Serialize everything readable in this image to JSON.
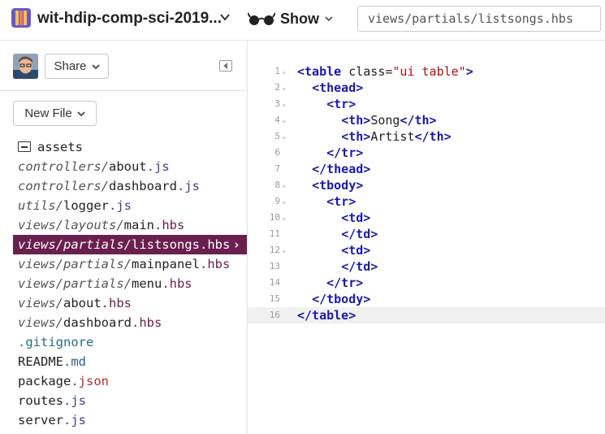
{
  "header": {
    "project_name": "wit-hdip-comp-sci-2019...",
    "show_label": "Show",
    "file_path": "views/partials/listsongs.hbs"
  },
  "sidebar": {
    "share_label": "Share",
    "new_file_label": "New File",
    "files": [
      {
        "dir": "",
        "name": "assets",
        "ext": "",
        "type": "folder"
      },
      {
        "dir": "controllers/",
        "name": "about",
        "ext": ".js"
      },
      {
        "dir": "controllers/",
        "name": "dashboard",
        "ext": ".js"
      },
      {
        "dir": "utils/",
        "name": "logger",
        "ext": ".js"
      },
      {
        "dir": "views/layouts/",
        "name": "main",
        "ext": ".hbs"
      },
      {
        "dir": "views/partials/",
        "name": "listsongs",
        "ext": ".hbs",
        "selected": true
      },
      {
        "dir": "views/partials/",
        "name": "mainpanel",
        "ext": ".hbs"
      },
      {
        "dir": "views/partials/",
        "name": "menu",
        "ext": ".hbs"
      },
      {
        "dir": "views/",
        "name": "about",
        "ext": ".hbs"
      },
      {
        "dir": "views/",
        "name": "dashboard",
        "ext": ".hbs"
      },
      {
        "dir": "",
        "name": ".gitignore",
        "ext": ""
      },
      {
        "dir": "",
        "name": "README",
        "ext": ".md"
      },
      {
        "dir": "",
        "name": "package",
        "ext": ".json"
      },
      {
        "dir": "",
        "name": "routes",
        "ext": ".js"
      },
      {
        "dir": "",
        "name": "server",
        "ext": ".js"
      }
    ]
  },
  "editor": {
    "active_line": 16,
    "lines": [
      {
        "n": "1",
        "fold": true,
        "indent": "",
        "parts": [
          [
            "tag",
            "<table"
          ],
          [
            "attr",
            " class="
          ],
          [
            "str",
            "\"ui table\""
          ],
          [
            "tag",
            ">"
          ]
        ]
      },
      {
        "n": "2",
        "fold": true,
        "indent": "  ",
        "parts": [
          [
            "tag",
            "<thead>"
          ]
        ]
      },
      {
        "n": "3",
        "fold": true,
        "indent": "    ",
        "parts": [
          [
            "tag",
            "<tr>"
          ]
        ]
      },
      {
        "n": "4",
        "fold": true,
        "indent": "      ",
        "parts": [
          [
            "tag",
            "<th>"
          ],
          [
            "txt",
            "Song"
          ],
          [
            "tag",
            "</th>"
          ]
        ]
      },
      {
        "n": "5",
        "fold": true,
        "indent": "      ",
        "parts": [
          [
            "tag",
            "<th>"
          ],
          [
            "txt",
            "Artist"
          ],
          [
            "tag",
            "</th>"
          ]
        ]
      },
      {
        "n": "6",
        "fold": false,
        "indent": "    ",
        "parts": [
          [
            "tag",
            "</tr>"
          ]
        ]
      },
      {
        "n": "7",
        "fold": false,
        "indent": "  ",
        "parts": [
          [
            "tag",
            "</thead>"
          ]
        ]
      },
      {
        "n": "8",
        "fold": true,
        "indent": "  ",
        "parts": [
          [
            "tag",
            "<tbody>"
          ]
        ]
      },
      {
        "n": "9",
        "fold": true,
        "indent": "    ",
        "parts": [
          [
            "tag",
            "<tr>"
          ]
        ]
      },
      {
        "n": "10",
        "fold": true,
        "indent": "      ",
        "parts": [
          [
            "tag",
            "<td>"
          ]
        ]
      },
      {
        "n": "11",
        "fold": false,
        "indent": "      ",
        "parts": [
          [
            "tag",
            "</td>"
          ]
        ]
      },
      {
        "n": "12",
        "fold": true,
        "indent": "      ",
        "parts": [
          [
            "tag",
            "<td>"
          ]
        ]
      },
      {
        "n": "13",
        "fold": false,
        "indent": "      ",
        "parts": [
          [
            "tag",
            "</td>"
          ]
        ]
      },
      {
        "n": "14",
        "fold": false,
        "indent": "    ",
        "parts": [
          [
            "tag",
            "</tr>"
          ]
        ]
      },
      {
        "n": "15",
        "fold": false,
        "indent": "  ",
        "parts": [
          [
            "tag",
            "</tbody>"
          ]
        ]
      },
      {
        "n": "16",
        "fold": false,
        "indent": "",
        "parts": [
          [
            "tag",
            "</table>"
          ]
        ]
      }
    ]
  },
  "colors": {
    "selected_bg": "#6b1f4f",
    "tag": "#1a1aa6",
    "string": "#a11",
    "logo": "#6a58c8"
  }
}
